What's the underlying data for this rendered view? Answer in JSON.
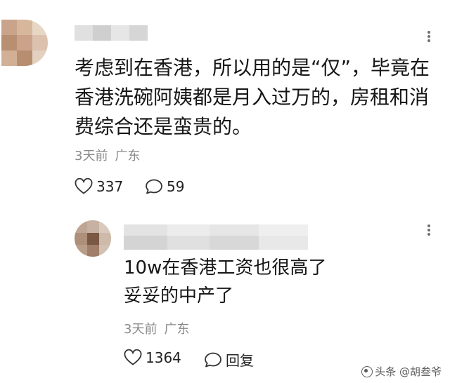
{
  "comments": [
    {
      "content": "考虑到在香港，所以用的是“仅”，毕竟在香港洗碗阿姨都是月入过万的，房租和消费综合还是蛮贵的。",
      "time": "3天前",
      "location": "广东",
      "likes": "337",
      "replies": "59"
    },
    {
      "content": "10w在香港工资也很高了 妥妥的中产了",
      "time": "3天前",
      "location": "广东",
      "likes": "1364",
      "reply_label": "回复"
    }
  ],
  "icons": {
    "like": "heart-outline-icon",
    "comment": "speech-bubble-icon",
    "more": "vertical-dots-icon"
  },
  "watermark": "头条 @胡叁爷"
}
